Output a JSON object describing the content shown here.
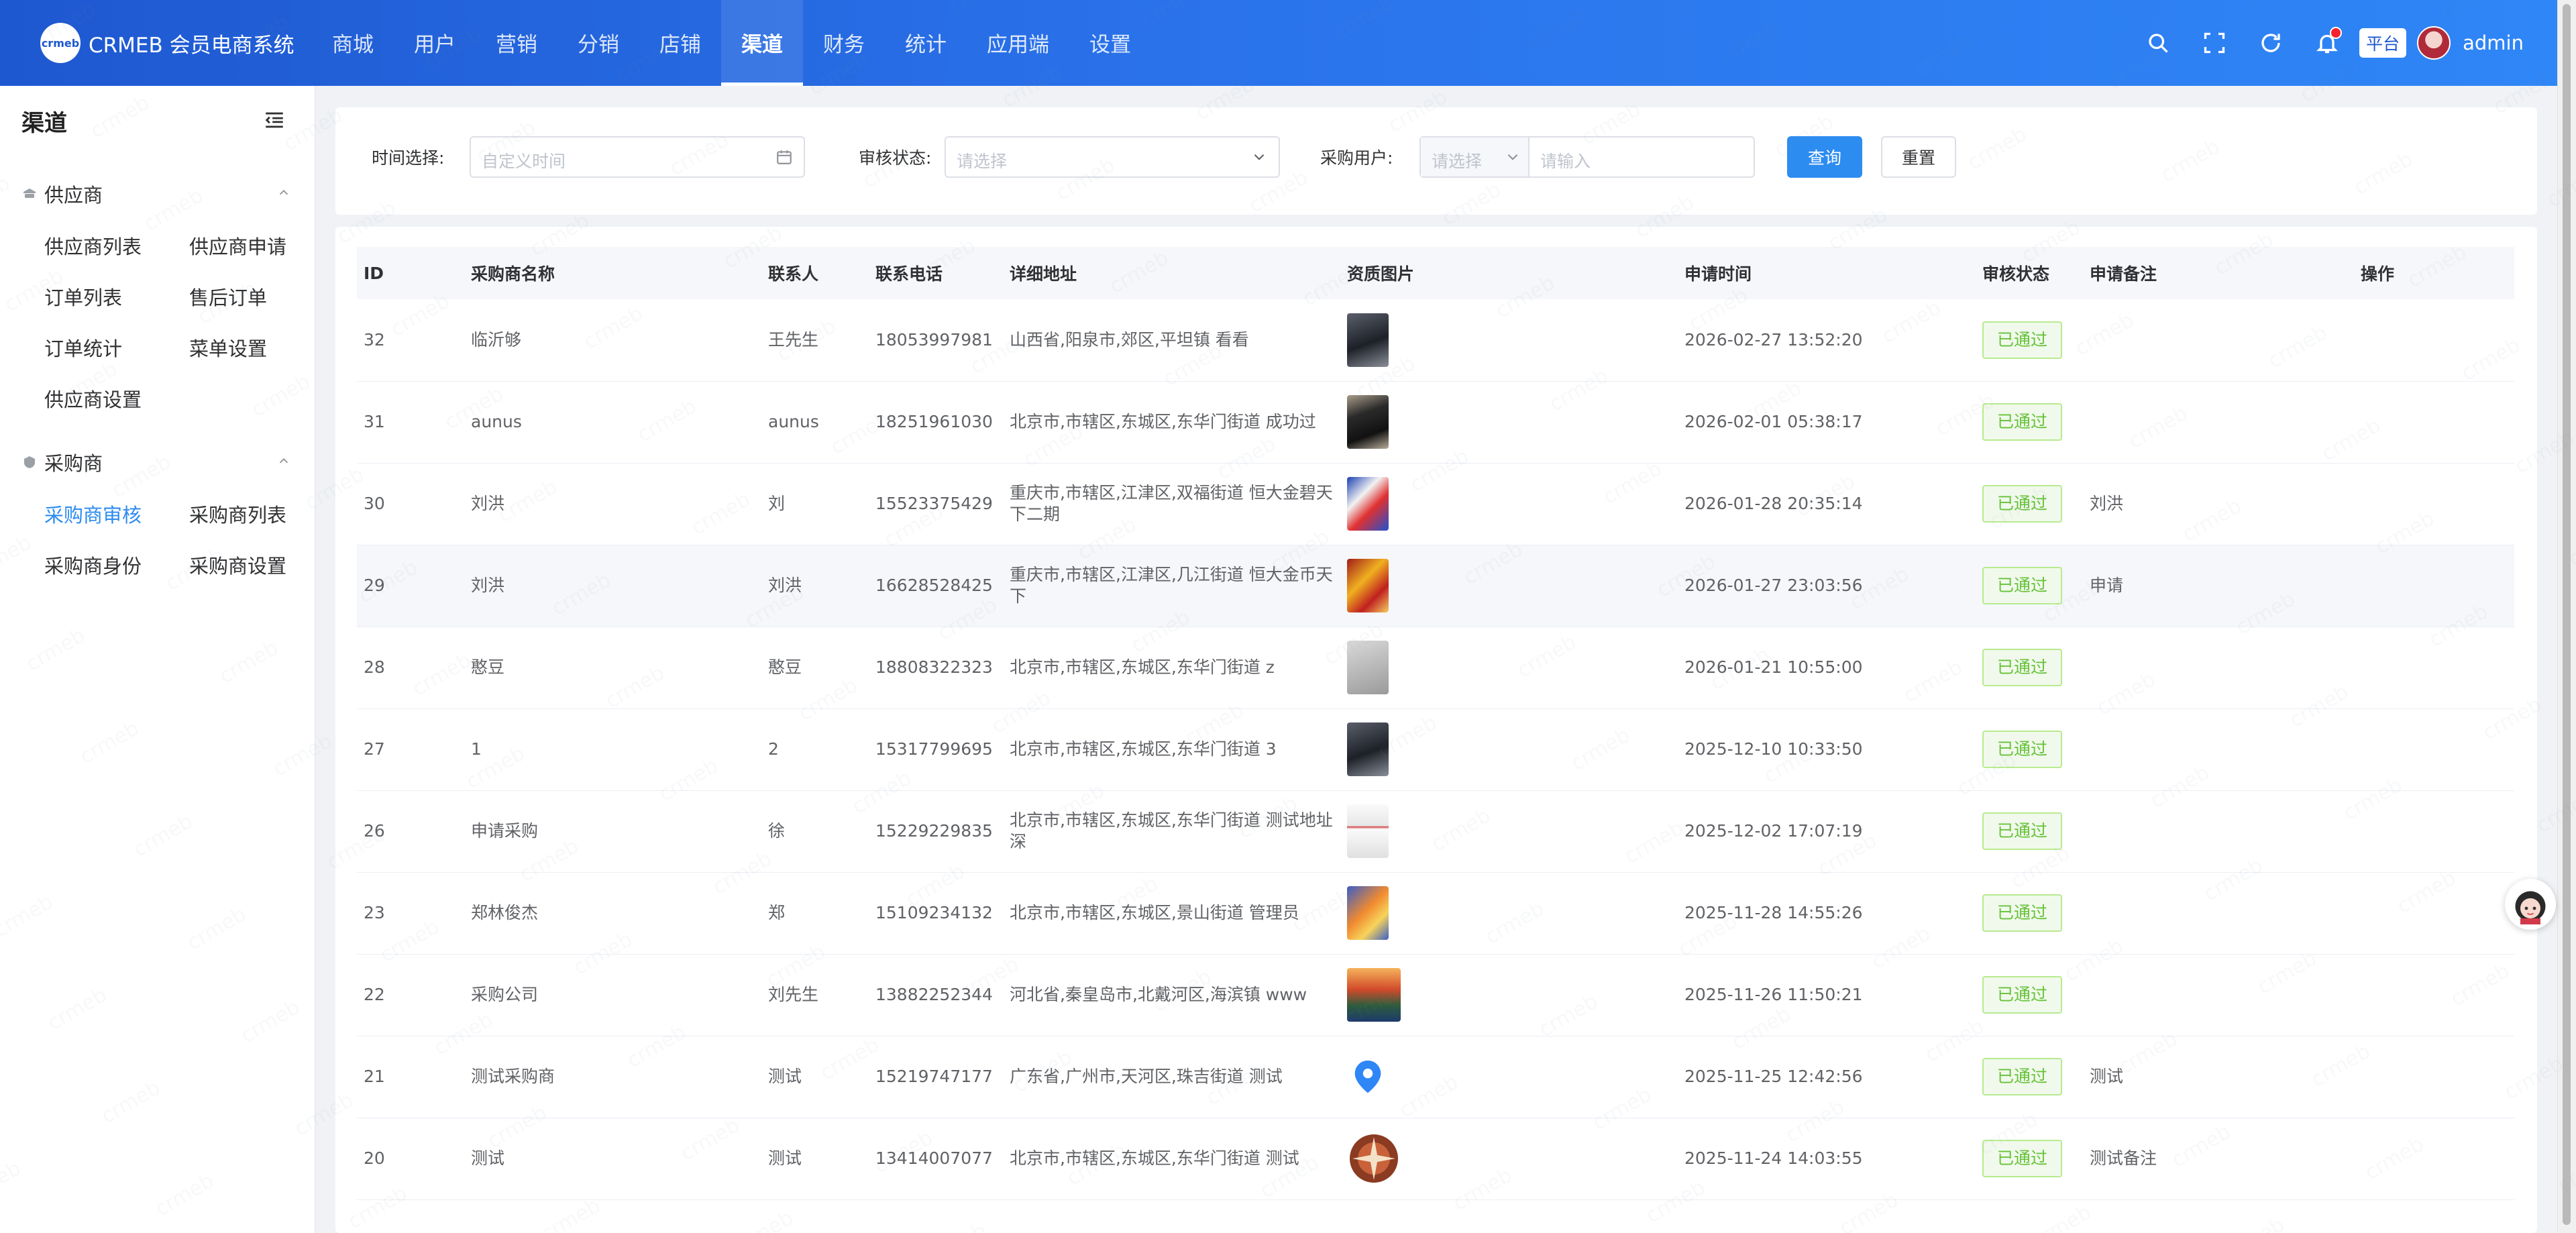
{
  "header": {
    "brand_logo_text": "crmeb",
    "brand_name": "CRMEB 会员电商系统",
    "nav": [
      "商城",
      "用户",
      "营销",
      "分销",
      "店铺",
      "渠道",
      "财务",
      "统计",
      "应用端",
      "设置"
    ],
    "active_nav": "渠道",
    "platform_badge": "平台",
    "username": "admin"
  },
  "sidebar": {
    "title": "渠道",
    "groups": [
      {
        "label": "供应商",
        "items": [
          "供应商列表",
          "供应商申请",
          "订单列表",
          "售后订单",
          "订单统计",
          "菜单设置",
          "供应商设置"
        ]
      },
      {
        "label": "采购商",
        "items": [
          "采购商审核",
          "采购商列表",
          "采购商身份",
          "采购商设置"
        ]
      }
    ],
    "active_item": "采购商审核"
  },
  "filters": {
    "time_label": "时间选择:",
    "time_placeholder": "自定义时间",
    "status_label": "审核状态:",
    "status_placeholder": "请选择",
    "user_label": "采购用户:",
    "user_select_placeholder": "请选择",
    "user_input_placeholder": "请输入",
    "search_button": "查询",
    "reset_button": "重置"
  },
  "table": {
    "columns": [
      "ID",
      "采购商名称",
      "联系人",
      "联系电话",
      "详细地址",
      "资质图片",
      "申请时间",
      "审核状态",
      "申请备注",
      "操作"
    ],
    "rows": [
      {
        "id": "32",
        "name": "临沂够",
        "contact": "王先生",
        "phone": "18053997981",
        "address": "山西省,阳泉市,郊区,平坦镇 看看",
        "image": "dark-device",
        "time": "2026-02-27 13:52:20",
        "status": "已通过",
        "remark": ""
      },
      {
        "id": "31",
        "name": "aunus",
        "contact": "aunus",
        "phone": "18251961030",
        "address": "北京市,市辖区,东城区,东华门街道 成功过",
        "image": "black-phone",
        "time": "2026-02-01 05:38:17",
        "status": "已通过",
        "remark": ""
      },
      {
        "id": "30",
        "name": "刘洪",
        "contact": "刘",
        "phone": "15523375429",
        "address": "重庆市,市辖区,江津区,双福街道 恒大金碧天下二期",
        "image": "colorful-packaging",
        "time": "2026-01-28 20:35:14",
        "status": "已通过",
        "remark": "刘洪"
      },
      {
        "id": "29",
        "name": "刘洪",
        "contact": "刘洪",
        "phone": "16628528425",
        "address": "重庆市,市辖区,江津区,几江街道 恒大金币天下",
        "image": "red-gold-box",
        "time": "2026-01-27 23:03:56",
        "status": "已通过",
        "remark": "申请"
      },
      {
        "id": "28",
        "name": "憨豆",
        "contact": "憨豆",
        "phone": "18808322323",
        "address": "北京市,市辖区,东城区,东华门街道 z",
        "image": "grey-card",
        "time": "2026-01-21 10:55:00",
        "status": "已通过",
        "remark": ""
      },
      {
        "id": "27",
        "name": "1",
        "contact": "2",
        "phone": "15317799695",
        "address": "北京市,市辖区,东城区,东华门街道 3",
        "image": "dark-device",
        "time": "2025-12-10 10:33:50",
        "status": "已通过",
        "remark": ""
      },
      {
        "id": "26",
        "name": "申请采购",
        "contact": "徐",
        "phone": "15229229835",
        "address": "北京市,市辖区,东城区,东华门街道 测试地址深",
        "image": "document-scan",
        "time": "2025-12-02 17:07:19",
        "status": "已通过",
        "remark": ""
      },
      {
        "id": "23",
        "name": "郑林俊杰",
        "contact": "郑",
        "phone": "15109234132",
        "address": "北京市,市辖区,东城区,景山街道 管理员",
        "image": "cartoon-fox",
        "time": "2025-11-28 14:55:26",
        "status": "已通过",
        "remark": ""
      },
      {
        "id": "22",
        "name": "采购公司",
        "contact": "刘先生",
        "phone": "13882252344",
        "address": "河北省,秦皇岛市,北戴河区,海滨镇 www",
        "image": "sunset-landscape",
        "time": "2025-11-26 11:50:21",
        "status": "已通过",
        "remark": ""
      },
      {
        "id": "21",
        "name": "测试采购商",
        "contact": "测试",
        "phone": "15219747177",
        "address": "广东省,广州市,天河区,珠吉街道 测试",
        "image": "blue-map-pin",
        "time": "2025-11-25 12:42:56",
        "status": "已通过",
        "remark": "测试"
      },
      {
        "id": "20",
        "name": "测试",
        "contact": "测试",
        "phone": "13414007077",
        "address": "北京市,市辖区,东城区,东华门街道 测试",
        "image": "compass-ornament",
        "time": "2025-11-24 14:03:55",
        "status": "已通过",
        "remark": "测试备注"
      }
    ]
  },
  "colors": {
    "header_start": "#1e58d0",
    "header_end": "#2f86f6",
    "accent": "#2d8cf0",
    "success": "#67c23a"
  }
}
